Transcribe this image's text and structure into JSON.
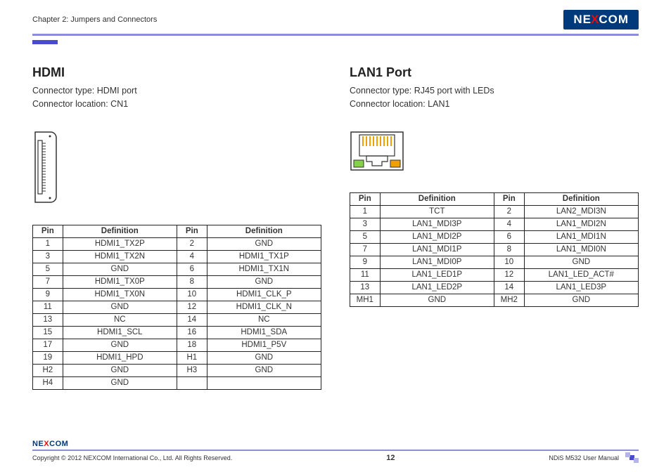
{
  "header": {
    "chapter": "Chapter 2: Jumpers and Connectors",
    "logo_text_pre": "NE",
    "logo_text_x": "X",
    "logo_text_post": "COM"
  },
  "hdmi": {
    "title": "HDMI",
    "desc_line1": "Connector type: HDMI port",
    "desc_line2": "Connector location: CN1",
    "table_headers": {
      "pin": "Pin",
      "def": "Definition"
    },
    "rows": [
      {
        "p1": "1",
        "d1": "HDMI1_TX2P",
        "p2": "2",
        "d2": "GND"
      },
      {
        "p1": "3",
        "d1": "HDMI1_TX2N",
        "p2": "4",
        "d2": "HDMI1_TX1P"
      },
      {
        "p1": "5",
        "d1": "GND",
        "p2": "6",
        "d2": "HDMI1_TX1N"
      },
      {
        "p1": "7",
        "d1": "HDMI1_TX0P",
        "p2": "8",
        "d2": "GND"
      },
      {
        "p1": "9",
        "d1": "HDMI1_TX0N",
        "p2": "10",
        "d2": "HDMI1_CLK_P"
      },
      {
        "p1": "11",
        "d1": "GND",
        "p2": "12",
        "d2": "HDMI1_CLK_N"
      },
      {
        "p1": "13",
        "d1": "NC",
        "p2": "14",
        "d2": "NC"
      },
      {
        "p1": "15",
        "d1": "HDMI1_SCL",
        "p2": "16",
        "d2": "HDMI1_SDA"
      },
      {
        "p1": "17",
        "d1": "GND",
        "p2": "18",
        "d2": "HDMI1_P5V"
      },
      {
        "p1": "19",
        "d1": "HDMI1_HPD",
        "p2": "H1",
        "d2": "GND"
      },
      {
        "p1": "H2",
        "d1": "GND",
        "p2": "H3",
        "d2": "GND"
      },
      {
        "p1": "H4",
        "d1": "GND",
        "p2": "",
        "d2": ""
      }
    ]
  },
  "lan1": {
    "title": "LAN1 Port",
    "desc_line1": "Connector type: RJ45 port with LEDs",
    "desc_line2": "Connector location: LAN1",
    "table_headers": {
      "pin": "Pin",
      "def": "Definition"
    },
    "rows": [
      {
        "p1": "1",
        "d1": "TCT",
        "p2": "2",
        "d2": "LAN2_MDI3N"
      },
      {
        "p1": "3",
        "d1": "LAN1_MDI3P",
        "p2": "4",
        "d2": "LAN1_MDI2N"
      },
      {
        "p1": "5",
        "d1": "LAN1_MDI2P",
        "p2": "6",
        "d2": "LAN1_MDI1N"
      },
      {
        "p1": "7",
        "d1": "LAN1_MDI1P",
        "p2": "8",
        "d2": "LAN1_MDI0N"
      },
      {
        "p1": "9",
        "d1": "LAN1_MDI0P",
        "p2": "10",
        "d2": "GND"
      },
      {
        "p1": "11",
        "d1": "LAN1_LED1P",
        "p2": "12",
        "d2": "LAN1_LED_ACT#"
      },
      {
        "p1": "13",
        "d1": "LAN1_LED2P",
        "p2": "14",
        "d2": "LAN1_LED3P"
      },
      {
        "p1": "MH1",
        "d1": "GND",
        "p2": "MH2",
        "d2": "GND"
      }
    ]
  },
  "footer": {
    "logo_pre": "NE",
    "logo_x": "X",
    "logo_post": "COM",
    "copyright": "Copyright © 2012 NEXCOM International Co., Ltd. All Rights Reserved.",
    "page": "12",
    "manual": "NDiS M532 User Manual"
  }
}
